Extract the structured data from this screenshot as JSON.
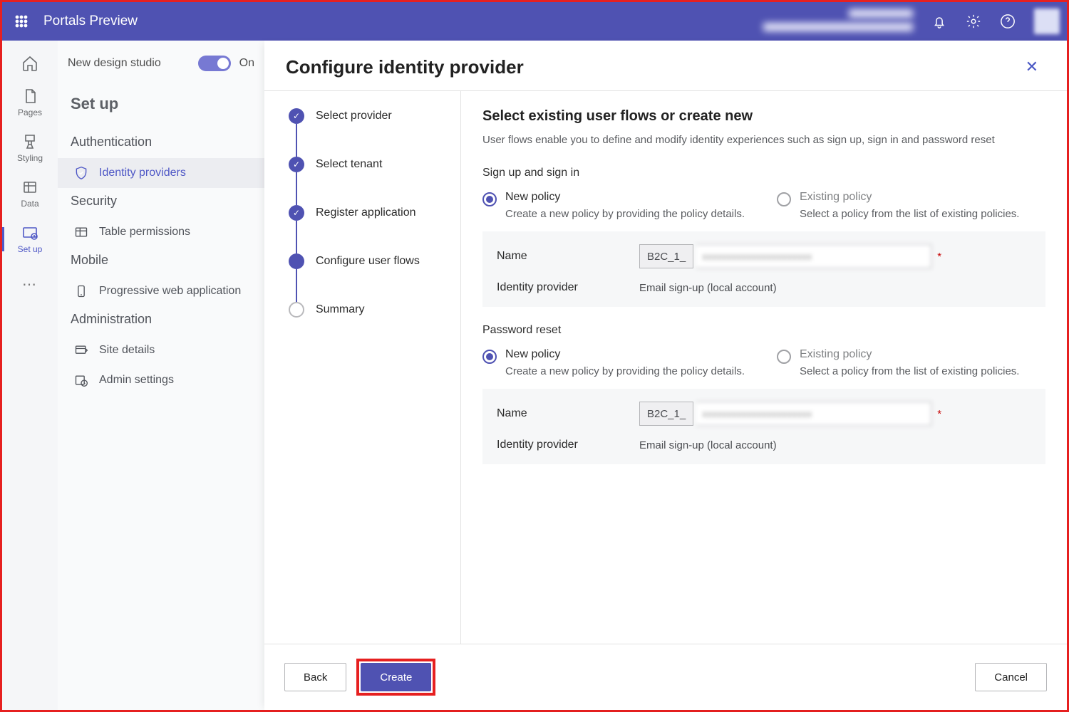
{
  "topbar": {
    "title": "Portals Preview"
  },
  "rail": {
    "pages": "Pages",
    "styling": "Styling",
    "data": "Data",
    "setup": "Set up"
  },
  "sidebar": {
    "toggle_label": "New design studio",
    "toggle_state": "On",
    "title": "Set up",
    "groups": {
      "auth": "Authentication",
      "security": "Security",
      "mobile": "Mobile",
      "admin": "Administration"
    },
    "items": {
      "identity_providers": "Identity providers",
      "table_permissions": "Table permissions",
      "pwa": "Progressive web application",
      "site_details": "Site details",
      "admin_settings": "Admin settings"
    }
  },
  "panel": {
    "title": "Configure identity provider",
    "steps": {
      "s1": "Select provider",
      "s2": "Select tenant",
      "s3": "Register application",
      "s4": "Configure user flows",
      "s5": "Summary"
    },
    "form": {
      "heading": "Select existing user flows or create new",
      "desc": "User flows enable you to define and modify identity experiences such as sign up, sign in and password reset",
      "signin_label": "Sign up and sign in",
      "pwd_label": "Password reset",
      "new_policy": "New policy",
      "new_policy_sub": "Create a new policy by providing the policy details.",
      "existing_policy": "Existing policy",
      "existing_policy_sub": "Select a policy from the list of existing policies.",
      "name_label": "Name",
      "prefix": "B2C_1_",
      "idp_label": "Identity provider",
      "idp_value": "Email sign-up (local account)"
    },
    "footer": {
      "back": "Back",
      "create": "Create",
      "cancel": "Cancel"
    }
  }
}
